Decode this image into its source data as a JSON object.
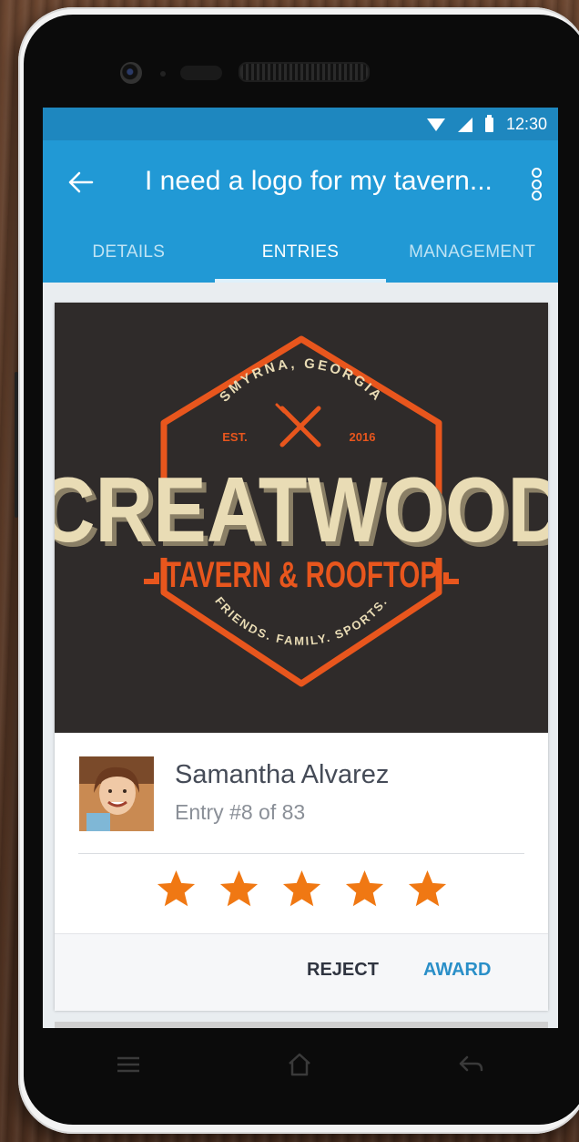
{
  "status_bar": {
    "time": "12:30"
  },
  "app_bar": {
    "title": "I need a logo for my tavern..."
  },
  "tabs": [
    {
      "label": "DETAILS",
      "active": false
    },
    {
      "label": "ENTRIES",
      "active": true
    },
    {
      "label": "MANAGEMENT",
      "active": false
    }
  ],
  "entry": {
    "logo": {
      "location": "SMYRNA, GEORGIA",
      "est_label": "EST.",
      "year": "2016",
      "name": "CREATWOOD",
      "subtitle": "TAVERN & ROOFTOP",
      "tagline": "FRIENDS. FAMILY. SPORTS."
    },
    "author_name": "Samantha Alvarez",
    "entry_label": "Entry #8 of 83",
    "rating": 5,
    "rating_max": 5,
    "reject_label": "REJECT",
    "award_label": "AWARD"
  },
  "colors": {
    "status_bar": "#1e87bf",
    "app_bar": "#2199d5",
    "logo_background": "#2f2b2a",
    "logo_orange": "#e8561d",
    "logo_cream": "#e9dcb5",
    "star": "#f07813",
    "award_text": "#2a8fc8"
  },
  "icons": {
    "back": "arrow-left-icon",
    "menu": "more-vert-icon",
    "wifi": "wifi-icon",
    "signal": "cell-signal-icon",
    "battery": "battery-icon",
    "nav_menu": "menu-icon",
    "nav_home": "home-icon",
    "nav_back": "back-icon",
    "logo_cross": "fork-knife-icon"
  }
}
